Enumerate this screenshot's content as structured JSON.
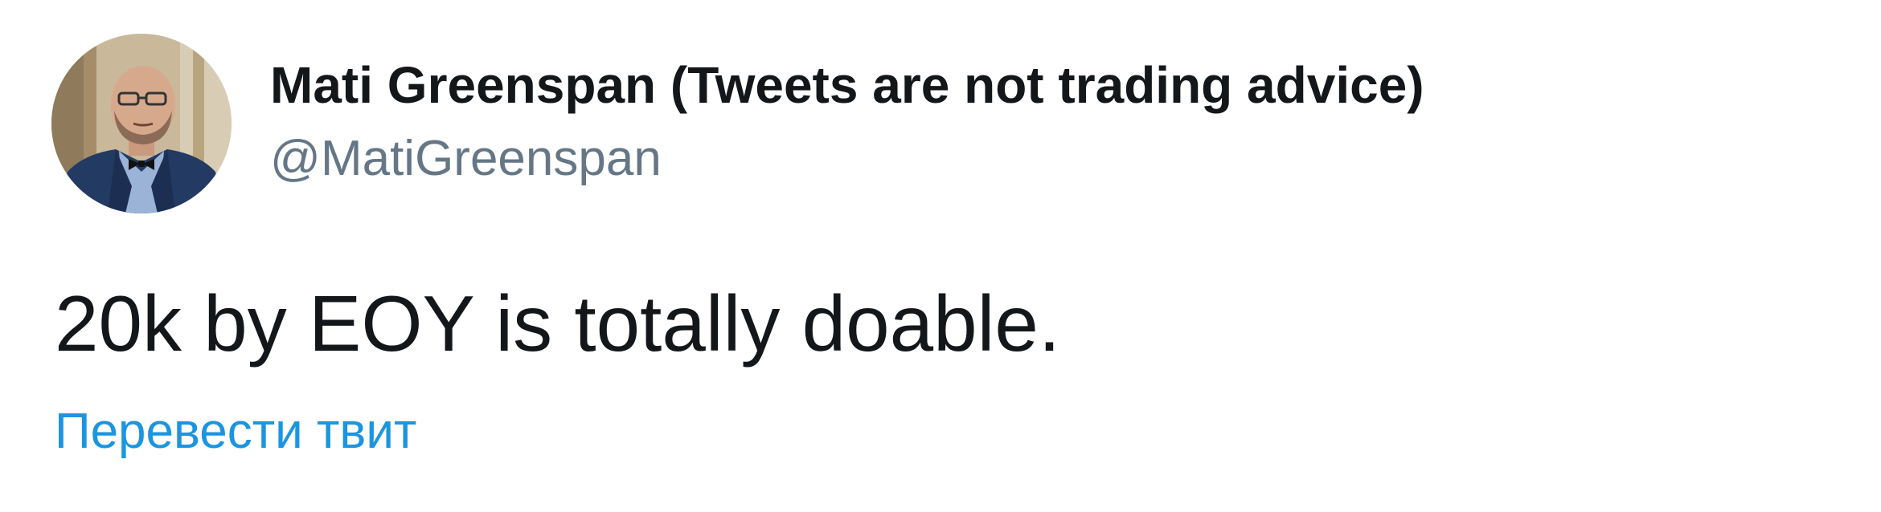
{
  "tweet": {
    "author": {
      "display_name": "Mati Greenspan (Tweets are not trading advice)",
      "handle": "@MatiGreenspan"
    },
    "text": "20k by EOY is totally doable.",
    "translate_label": "Перевести твит"
  },
  "colors": {
    "text_primary": "#14171a",
    "text_secondary": "#657786",
    "link": "#1b95e0",
    "background": "#ffffff"
  }
}
